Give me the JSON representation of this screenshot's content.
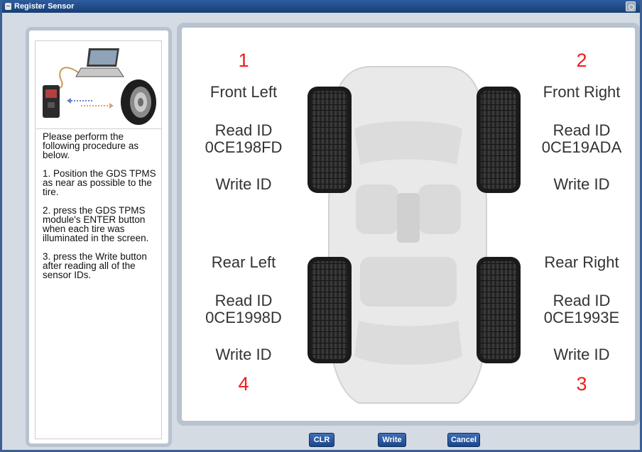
{
  "window": {
    "title": "Register Sensor"
  },
  "instructions": [
    "Please perform the following procedure as below.",
    "1. Position the GDS TPMS as near as possible to the tire.",
    "2. press the GDS TPMS module's ENTER button when each tire was illuminated in the screen.",
    "3. press the Write button after reading all of the sensor IDs."
  ],
  "tires": {
    "front_left": {
      "number": "1",
      "label": "Front Left",
      "read_label": "Read ID",
      "read_value": "0CE198FD",
      "write_label": "Write ID"
    },
    "front_right": {
      "number": "2",
      "label": "Front Right",
      "read_label": "Read ID",
      "read_value": "0CE19ADA",
      "write_label": "Write ID"
    },
    "rear_left": {
      "number": "4",
      "label": "Rear Left",
      "read_label": "Read ID",
      "read_value": "0CE1998D",
      "write_label": "Write ID"
    },
    "rear_right": {
      "number": "3",
      "label": "Rear Right",
      "read_label": "Read ID",
      "read_value": "0CE1993E",
      "write_label": "Write ID"
    }
  },
  "buttons": {
    "clr": "CLR",
    "write": "Write",
    "cancel": "Cancel"
  },
  "colors": {
    "title_bar": "#1f4a85",
    "panel_border": "#b9c3cf",
    "tire_number": "#ef1c1c",
    "button": "#2b5aa0"
  }
}
